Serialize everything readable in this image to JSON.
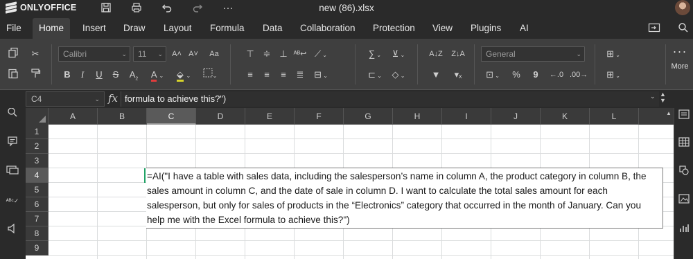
{
  "app": {
    "logo_text": "ONLYOFFICE",
    "doc_title": "new (86).xlsx"
  },
  "titlebar": {
    "icons": [
      "save-icon",
      "print-icon",
      "undo-icon",
      "redo-icon",
      "more-icon"
    ],
    "more_label": "···"
  },
  "menu": {
    "tabs": [
      "File",
      "Home",
      "Insert",
      "Draw",
      "Layout",
      "Formula",
      "Data",
      "Collaboration",
      "Protection",
      "View",
      "Plugins",
      "AI"
    ],
    "active_tab": "Home"
  },
  "toolbar": {
    "font_name": "Calibri",
    "font_size": "11",
    "number_format": "General",
    "more_label": "More",
    "bold": "B",
    "italic": "I",
    "underline": "U",
    "strike": "S",
    "increase_font": "A˄",
    "decrease_font": "A˅",
    "change_case": "Aa",
    "sum": "∑",
    "percent": "%",
    "comma": "9",
    "decimals_dec": ".0",
    "decimals_inc": ".00"
  },
  "formula_bar": {
    "cell_ref": "C4",
    "fx": "fx",
    "content": "formula to achieve this?\")"
  },
  "sheet": {
    "columns": [
      "A",
      "B",
      "C",
      "D",
      "E",
      "F",
      "G",
      "H",
      "I",
      "J",
      "K",
      "L"
    ],
    "selected_column": "C",
    "rows": [
      "1",
      "2",
      "3",
      "4",
      "5",
      "6",
      "7",
      "8",
      "9"
    ],
    "selected_row": "4",
    "cell_editor_text": "=AI(\"I have a table with sales data, including the salesperson’s name in column A, the product category in column B, the sales amount in column C, and the date of sale in column D. I want to calculate the total sales amount for each salesperson, but only for sales of products in the “Electronics” category that occurred in the month of January. Can you help me with the Excel formula to achieve this?\")"
  },
  "colors": {
    "accent_active_cell": "#21a366",
    "toolbar_bg": "#3f3f3f",
    "window_bg": "#2a2a2a"
  }
}
